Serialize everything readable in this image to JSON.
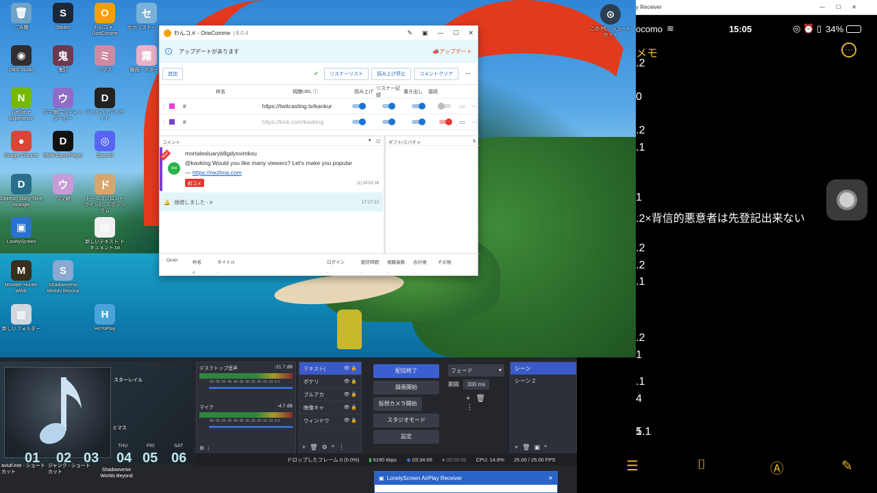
{
  "desktop": {
    "icons": [
      {
        "label": "ごみ箱",
        "icon": "recycle-bin-icon",
        "glyph": "🗑",
        "color": "#6fa3c8"
      },
      {
        "label": "Steam",
        "icon": "steam-icon",
        "glyph": "S",
        "color": "#1b2838"
      },
      {
        "label": "わんコメ - OneComme",
        "icon": "onecomme-icon",
        "glyph": "O",
        "color": "#f5a000"
      },
      {
        "label": "セカリストーリー",
        "icon": "game-icon",
        "glyph": "セ",
        "color": "#7ab1d8"
      },
      {
        "label": "OBS Studio",
        "icon": "obs-icon",
        "glyph": "◉",
        "color": "#302e31"
      },
      {
        "label": "鬼灯",
        "icon": "game-icon",
        "glyph": "鬼",
        "color": "#6c3a4e"
      },
      {
        "label": "ミマス",
        "icon": "game-icon",
        "glyph": "ミ",
        "color": "#d08aa3"
      },
      {
        "label": "霧雨・スターレ",
        "icon": "game-icon",
        "glyph": "霧",
        "color": "#e9b2c8"
      },
      {
        "label": "GeForce Experience",
        "icon": "nvidia-icon",
        "glyph": "N",
        "color": "#76b900"
      },
      {
        "label": "ウマ娘 プリティーダービー",
        "icon": "umamusume-icon",
        "glyph": "ウ",
        "color": "#8f6cc8"
      },
      {
        "label": "デッドバイデイライト",
        "icon": "dbd-icon",
        "glyph": "D",
        "color": "#222"
      },
      {
        "label": "Google Chrome",
        "icon": "chrome-icon",
        "glyph": "●",
        "color": "#db4437"
      },
      {
        "label": "DMM GamePlayer",
        "icon": "dmm-icon",
        "glyph": "D",
        "color": "#111"
      },
      {
        "label": "Discord",
        "icon": "discord-icon",
        "glyph": "◎",
        "color": "#5865f2"
      },
      {
        "label": "Digimon Story Time Stranger",
        "icon": "digimon-icon",
        "glyph": "D",
        "color": "#2a6e8c"
      },
      {
        "label": "ウマ娘",
        "icon": "umamusume-icon",
        "glyph": "ウ",
        "color": "#c79ad8"
      },
      {
        "label": "ドールズフロントライン2：エクシリウム",
        "icon": "game-icon",
        "glyph": "ド",
        "color": "#d8a56c"
      },
      {
        "label": "LonelyScreen",
        "icon": "lonelyscreen-icon",
        "glyph": "▣",
        "color": "#2a72d0"
      },
      {
        "label": "新しいテキスト ドキュメント.txt",
        "icon": "text-file-icon",
        "glyph": "▤",
        "color": "#f0f0f0"
      },
      {
        "label": "Monster Hunter Wilds",
        "icon": "mhw-icon",
        "glyph": "M",
        "color": "#3a2e1c"
      },
      {
        "label": "Shadowverse Worlds Beyond",
        "icon": "shadowverse-icon",
        "glyph": "S",
        "color": "#8aa8d0"
      },
      {
        "label": "新しいフォルダー",
        "icon": "folder-icon",
        "glyph": "▦",
        "color": "#cfd7df"
      },
      {
        "label": "HoYoPlay",
        "icon": "hoyoplay-icon",
        "glyph": "H",
        "color": "#4aa3d8"
      },
      {
        "label": "この PC - ショートカット",
        "icon": "pc-icon",
        "glyph": "⊙",
        "color": "#2c3e50"
      }
    ]
  },
  "onecomme": {
    "title": "わんコメ - OneComme",
    "version": "8.0.4",
    "update_notice": "アップデートがあります",
    "update_button": "アップデート",
    "add_button": "追加",
    "listener_list": "リスナーリスト",
    "stop_reading": "読み上げ停止",
    "comment_clear": "コメントクリア",
    "headers": {
      "name": "枠名",
      "url": "視聴URL",
      "read": "読み上げ",
      "listener": "リスナー記録",
      "write": "書き出し",
      "connect": "接続"
    },
    "rows": [
      {
        "color": "#e83fd9",
        "name": "#",
        "url": "https://twitcasting.tv/kankur",
        "enabled": true
      },
      {
        "color": "#7a3fd1",
        "name": "#",
        "url": "https://kick.com/kavking",
        "enabled": false
      }
    ],
    "comment_panel": "コメント",
    "gift_panel": "ギフト/スパチャ",
    "comment": {
      "tag": "New!",
      "avatar": "mo",
      "user": "mortalesluaryb8gdysvimkxu",
      "text": "@kavking Would you like many viewers? Let's make you popular — ",
      "link": "https://nezhna.com",
      "badge": "初コメ",
      "meta": "(1)  20:52:16"
    },
    "connected_msg": "接続しました - #",
    "connected_time": "17:27:12",
    "footer_headers": [
      "OnAir",
      "枠名",
      "タイトル",
      "ログイン",
      "配信時間",
      "視聴者数",
      "合計視",
      "その他"
    ],
    "footer_row": [
      "#",
      "-",
      "-",
      "-",
      "-",
      "-"
    ]
  },
  "obs": {
    "mixer": [
      {
        "name": "デスクトップ音声",
        "db": "-21.7 dB"
      },
      {
        "name": "マイク",
        "db": "-4.7 dB"
      }
    ],
    "meter_ticks": "-60 -55 -50 -45 -40 -35 -30 -25 -20 -15 -10 -5 0",
    "sources": [
      "テキスト(",
      "ボケリ",
      "ブルアカ",
      "映像キャ",
      "ウィンドウ"
    ],
    "controls": {
      "stop_stream": "配信終了",
      "record": "録画開始",
      "virtual_cam": "仮想カメラ開始",
      "studio": "スタジオモード",
      "settings": "設定"
    },
    "transition": {
      "name": "フェード",
      "label": "期間",
      "duration": "300 ms"
    },
    "scenes": [
      "シーン",
      "シーン 2"
    ],
    "status": {
      "dropped": "ドロップしたフレーム 0 (0.0%)",
      "bitrate": "6190 kbps",
      "stream_time": "03:34:06",
      "rec_time": "00:00:00",
      "cpu": "CPU: 14.8%",
      "fps": "25.00 / 25.00 FPS"
    },
    "preview_labels": [
      "スターレイル",
      "ミマス"
    ]
  },
  "taskbar": {
    "items": [
      "aviutl.exe - ショートカット",
      "ジャンク - ショートカット",
      "Shadowverse Worlds Beyond"
    ],
    "days": [
      {
        "d": "THU",
        "n": "04"
      },
      {
        "d": "FRI",
        "n": "05"
      },
      {
        "d": "SAT",
        "n": "06"
      }
    ],
    "left_nums": [
      "01",
      "02",
      "03"
    ]
  },
  "phone": {
    "window_title": "y Receiver",
    "carrier": "ocomo",
    "time": "15:05",
    "battery": "34%",
    "nav_title": "メモ",
    "lines": [
      ".2",
      "0",
      ".2",
      ".1",
      "1",
      ".2×背信的悪意者は先登記出来ない",
      ".2",
      ".2",
      ".1",
      ".2",
      "1",
      ".1",
      "4",
      "1.1",
      "5"
    ]
  },
  "lonelyscreen": {
    "title": "LonelyScreen AirPlay Receiver"
  }
}
